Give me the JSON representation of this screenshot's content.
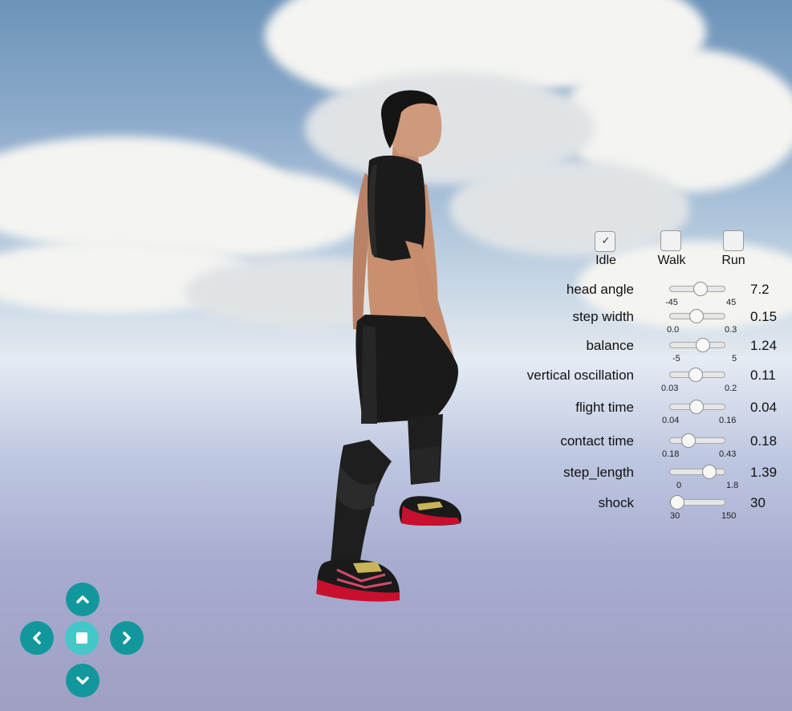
{
  "modes": [
    {
      "label": "Idle",
      "checked": true
    },
    {
      "label": "Walk",
      "checked": false
    },
    {
      "label": "Run",
      "checked": false
    }
  ],
  "params": [
    {
      "label": "head angle",
      "min": "-45",
      "max": "45",
      "value": "7.2"
    },
    {
      "label": "step width",
      "min": "0.0",
      "max": "0.3",
      "value": "0.15"
    },
    {
      "label": "balance",
      "min": "-5",
      "max": "5",
      "value": "1.24"
    },
    {
      "label": "vertical oscillation",
      "min": "0.03",
      "max": "0.2",
      "value": "0.11"
    },
    {
      "label": "flight time",
      "min": "0.04",
      "max": "0.16",
      "value": "0.04"
    },
    {
      "label": "contact time",
      "min": "0.18",
      "max": "0.43",
      "value": "0.18"
    },
    {
      "label": "step_length",
      "min": "0",
      "max": "1.8",
      "value": "1.39"
    },
    {
      "label": "shock",
      "min": "30",
      "max": "150",
      "value": "30"
    }
  ],
  "icons": {
    "up": "chevron-up-icon",
    "down": "chevron-down-icon",
    "left": "chevron-left-icon",
    "right": "chevron-right-icon",
    "stop": "stop-icon",
    "tick": "check-icon"
  },
  "colors": {
    "dpad": "#12989c",
    "dpad_center": "#44c7c9"
  }
}
